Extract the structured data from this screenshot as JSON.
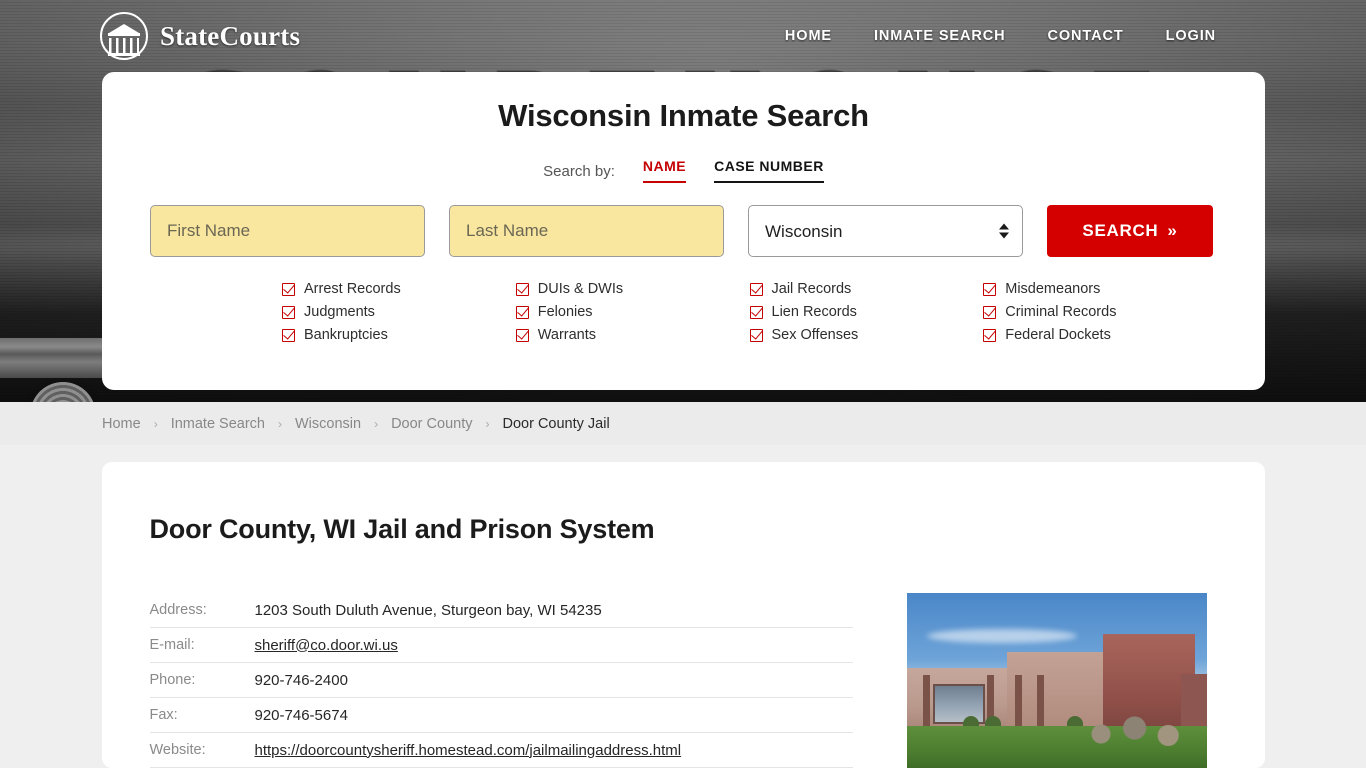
{
  "site": {
    "brand_name": "StateCourts",
    "logo_icon": "courthouse-circle-icon"
  },
  "nav": {
    "items": [
      {
        "label": "HOME"
      },
      {
        "label": "INMATE SEARCH"
      },
      {
        "label": "CONTACT"
      },
      {
        "label": "LOGIN"
      }
    ]
  },
  "search_panel": {
    "title": "Wisconsin Inmate Search",
    "search_by_label": "Search by:",
    "tabs": [
      {
        "label": "NAME",
        "active": true
      },
      {
        "label": "CASE NUMBER",
        "active": false
      }
    ],
    "first_name_placeholder": "First Name",
    "first_name_value": "",
    "last_name_placeholder": "Last Name",
    "last_name_value": "",
    "state_selected": "Wisconsin",
    "state_options": [
      "Wisconsin"
    ],
    "search_button_label": "SEARCH",
    "search_button_chevrons": "»",
    "record_types": [
      "Arrest Records",
      "DUIs & DWIs",
      "Jail Records",
      "Misdemeanors",
      "Judgments",
      "Felonies",
      "Lien Records",
      "Criminal Records",
      "Bankruptcies",
      "Warrants",
      "Sex Offenses",
      "Federal Dockets"
    ],
    "accent_color": "#c40000",
    "button_color": "#d40000",
    "field_fill_color": "#fae79f"
  },
  "breadcrumb": {
    "separator": "›",
    "items": [
      {
        "label": "Home",
        "current": false
      },
      {
        "label": "Inmate Search",
        "current": false
      },
      {
        "label": "Wisconsin",
        "current": false
      },
      {
        "label": "Door County",
        "current": false
      },
      {
        "label": "Door County Jail",
        "current": true
      }
    ]
  },
  "facility": {
    "title": "Door County, WI Jail and Prison System",
    "photo_alt": "door-county-jail-building-photo",
    "details": [
      {
        "key": "Address:",
        "value": "1203 South Duluth Avenue, Sturgeon bay, WI 54235",
        "link": false
      },
      {
        "key": "E-mail:",
        "value": "sheriff@co.door.wi.us",
        "link": true
      },
      {
        "key": "Phone:",
        "value": "920-746-2400",
        "link": false
      },
      {
        "key": "Fax:",
        "value": "920-746-5674",
        "link": false
      },
      {
        "key": "Website:",
        "value": "https://doorcountysheriff.homestead.com/jailmailingaddress.html",
        "link": true
      }
    ]
  },
  "hero": {
    "background_lettering": "COURTHOUSE"
  }
}
